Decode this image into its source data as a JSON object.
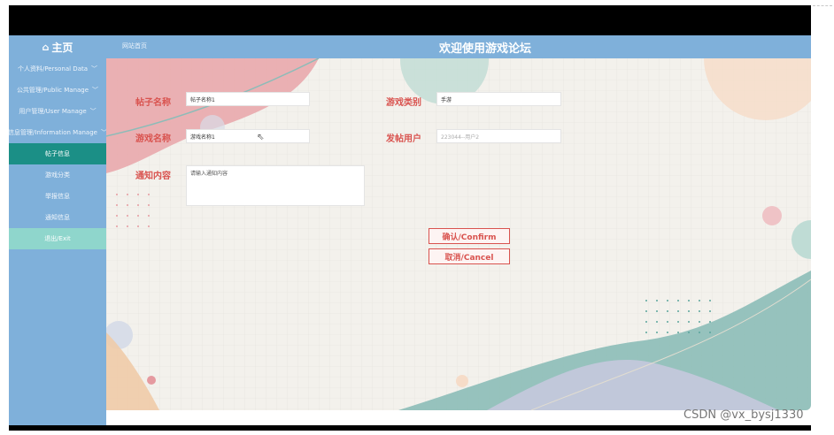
{
  "header": {
    "home_label": "主页",
    "breadcrumb": "网站首页",
    "welcome": "欢迎使用游戏论坛"
  },
  "sidebar": {
    "items": [
      {
        "label": "个人资料/Personal Data",
        "chevron": "﹀"
      },
      {
        "label": "公共管理/Public Manage",
        "chevron": "﹀"
      },
      {
        "label": "用户管理/User Manage",
        "chevron": "﹀"
      },
      {
        "label": "信息管理/Information Manage",
        "chevron": "﹀"
      },
      {
        "label": "帖子信息"
      },
      {
        "label": "游戏分类"
      },
      {
        "label": "举报信息"
      },
      {
        "label": "通知信息"
      },
      {
        "label": "退出/Exit"
      }
    ]
  },
  "form": {
    "post_name_label": "帖子名称",
    "post_name_value": "帖子名称1",
    "game_category_label": "游戏类别",
    "game_category_value": "手游",
    "game_name_label": "游戏名称",
    "game_name_value": "游戏名称1",
    "poster_label": "发帖用户",
    "poster_placeholder": "223044--用户2",
    "notice_label": "通知内容",
    "notice_placeholder": "请输入通知内容",
    "confirm_label": "确认/Confirm",
    "cancel_label": "取消/Cancel"
  },
  "watermark": "CSDN @vx_bysj1330",
  "colors": {
    "header_bg": "#7fb0da",
    "active_menu": "#1b8f86",
    "exit_menu": "#8fd6cc",
    "label_red": "#d9534f"
  }
}
